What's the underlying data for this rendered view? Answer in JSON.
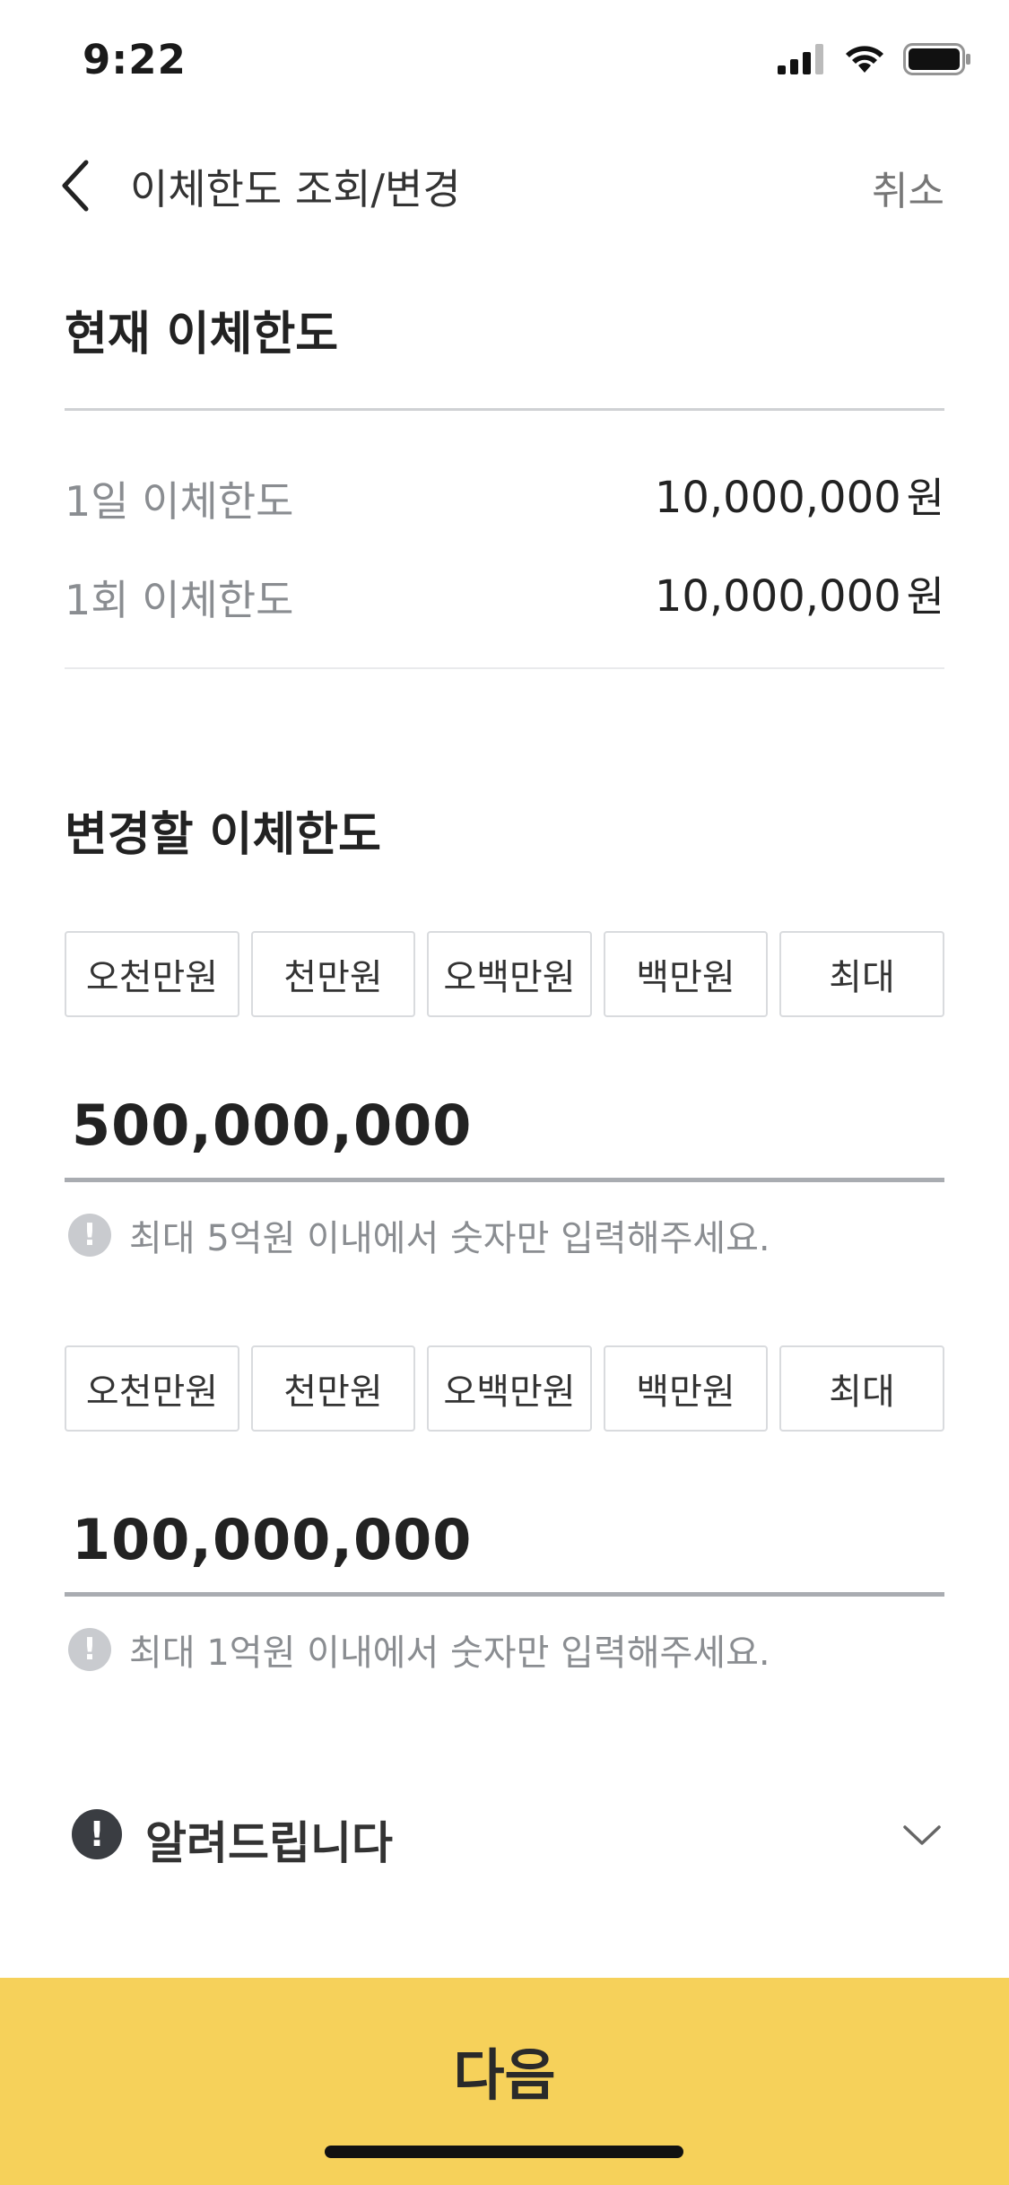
{
  "status_bar": {
    "time": "9:22"
  },
  "nav": {
    "title": "이체한도 조회/변경",
    "cancel": "취소"
  },
  "current": {
    "title": "현재 이체한도",
    "rows": [
      {
        "label": "1일 이체한도",
        "value": "10,000,000",
        "unit": "원"
      },
      {
        "label": "1회 이체한도",
        "value": "10,000,000",
        "unit": "원"
      }
    ]
  },
  "change": {
    "title": "변경할 이체한도",
    "quick_buttons_1": [
      "오천만원",
      "천만원",
      "오백만원",
      "백만원",
      "최대"
    ],
    "daily_amount": "500,000,000",
    "daily_hint": "최대 5억원 이내에서 숫자만 입력해주세요.",
    "quick_buttons_2": [
      "오천만원",
      "천만원",
      "오백만원",
      "백만원",
      "최대"
    ],
    "once_amount": "100,000,000",
    "once_hint": "최대 1억원 이내에서 숫자만 입력해주세요."
  },
  "notice": {
    "label": "알려드립니다",
    "icon": "!"
  },
  "footer": {
    "next": "다음"
  },
  "colors": {
    "accent": "#f6d15a",
    "muted": "#8a8d91"
  }
}
